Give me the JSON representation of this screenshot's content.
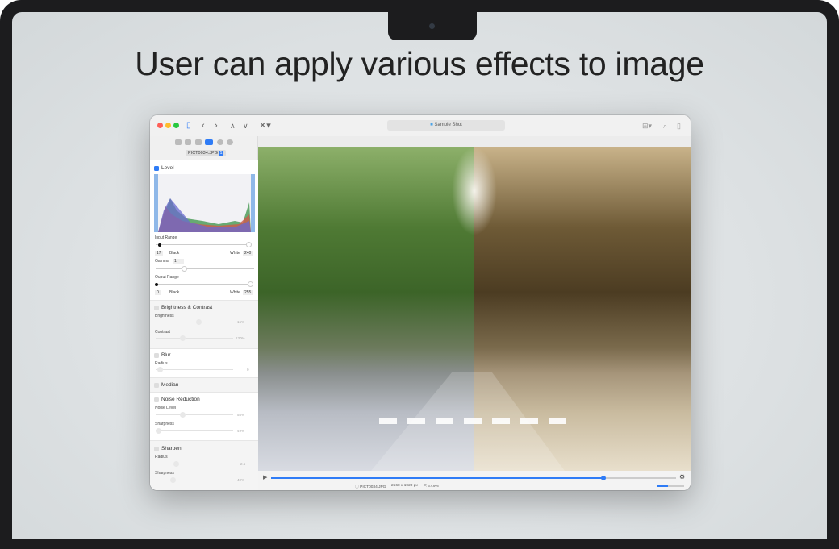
{
  "headline": "User can apply various effects to image",
  "window": {
    "title": "Sample Shot",
    "filename": "PICT0034.JPG",
    "filename_badge": "1"
  },
  "level": {
    "title": "Level",
    "enabled": true,
    "input_range_label": "Input Range",
    "input_black": "17",
    "black_label": "Black",
    "white_label": "White",
    "input_white": "240",
    "gamma_label": "Gamma",
    "gamma": "1",
    "output_range_label": "Ouput Range",
    "output_black": "0",
    "output_white": "255"
  },
  "brightness_contrast": {
    "title": "Brightness & Contrast",
    "brightness_label": "Brightness",
    "brightness": "16%",
    "contrast_label": "Contrast",
    "contrast": "130%"
  },
  "blur": {
    "title": "Blur",
    "radius_label": "Radius",
    "radius": "0"
  },
  "median": {
    "title": "Median"
  },
  "noise": {
    "title": "Noise Reduction",
    "level_label": "Noise Level",
    "level": "55%",
    "sharpness_label": "Sharpness",
    "sharpness": "49%"
  },
  "sharpen": {
    "title": "Sharpen",
    "radius_label": "Radius",
    "radius": "2.5",
    "sharpness_label": "Sharpness",
    "sharpness": "40%"
  },
  "status": {
    "file": "PICT0034.JPG",
    "dimensions": "2560 x 1920 px",
    "zoom": "67.9%"
  },
  "playback_progress": 0.82,
  "colors": {
    "accent": "#2f7cf6",
    "close": "#fe5f57",
    "minimize": "#febc2e",
    "zoom": "#28c840"
  }
}
